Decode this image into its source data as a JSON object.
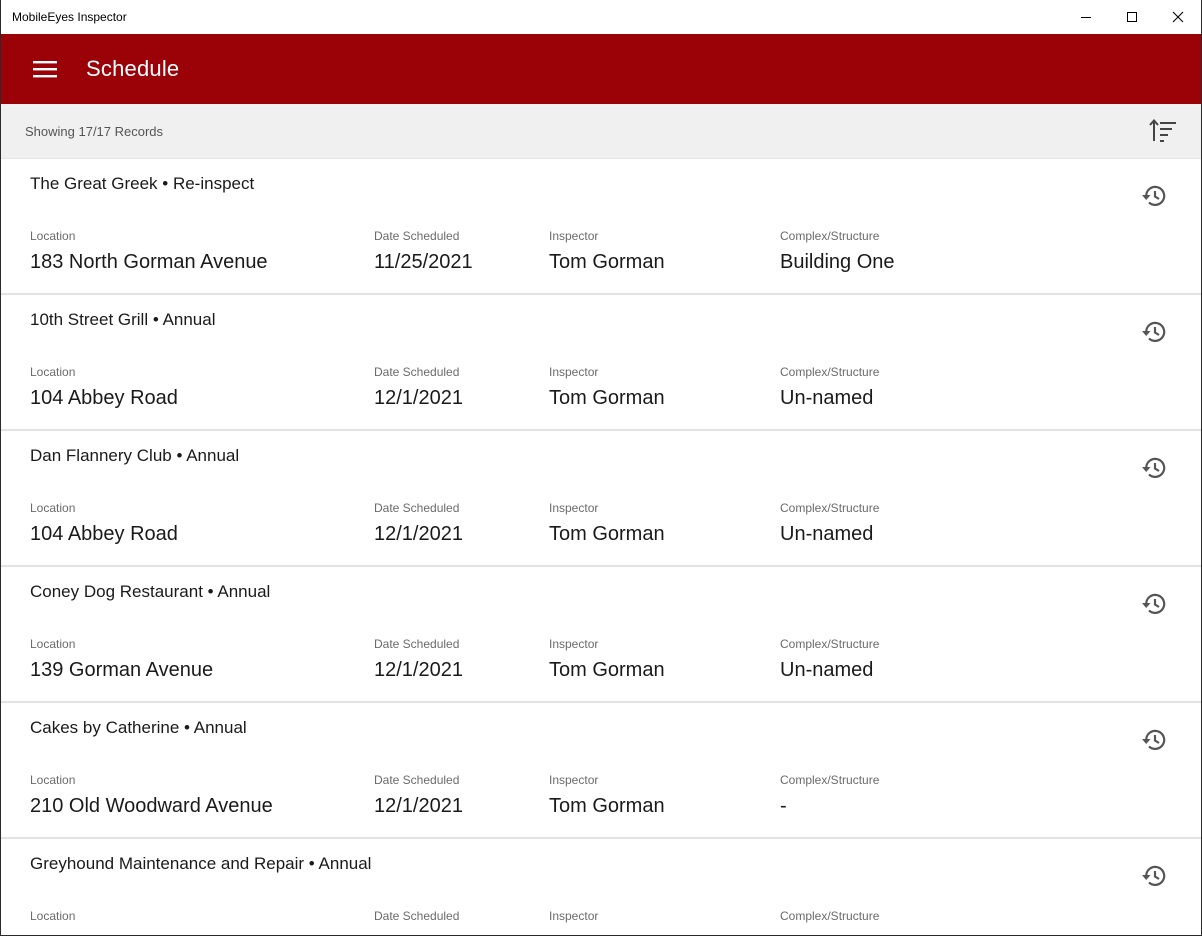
{
  "window": {
    "title": "MobileEyes Inspector",
    "controls": [
      "minimize-icon",
      "maximize-icon",
      "close-icon"
    ]
  },
  "header": {
    "menu_icon": "hamburger-menu-icon",
    "title": "Schedule"
  },
  "records_bar": {
    "text": "Showing 17/17 Records",
    "sort_icon": "sort-icon"
  },
  "colors": {
    "accent": "#9b0207",
    "records_bar_bg": "#f0f0f0"
  },
  "labels": {
    "location": "Location",
    "date": "Date Scheduled",
    "inspector": "Inspector",
    "complex": "Complex/Structure"
  },
  "items": [
    {
      "title": "The Great Greek • Re-inspect",
      "location": "183 North Gorman Avenue",
      "date": "11/25/2021",
      "inspector": "Tom Gorman",
      "complex": "Building One"
    },
    {
      "title": "10th Street Grill • Annual",
      "location": "104 Abbey Road",
      "date": "12/1/2021",
      "inspector": "Tom Gorman",
      "complex": "Un-named"
    },
    {
      "title": "Dan Flannery Club • Annual",
      "location": "104 Abbey Road",
      "date": "12/1/2021",
      "inspector": "Tom Gorman",
      "complex": "Un-named"
    },
    {
      "title": "Coney Dog Restaurant • Annual",
      "location": "139 Gorman Avenue",
      "date": "12/1/2021",
      "inspector": "Tom Gorman",
      "complex": "Un-named"
    },
    {
      "title": "Cakes by Catherine • Annual",
      "location": "210 Old Woodward Avenue",
      "date": "12/1/2021",
      "inspector": "Tom Gorman",
      "complex": "-"
    },
    {
      "title": "Greyhound Maintenance and Repair • Annual",
      "location": "",
      "date": "",
      "inspector": "",
      "complex": ""
    }
  ]
}
